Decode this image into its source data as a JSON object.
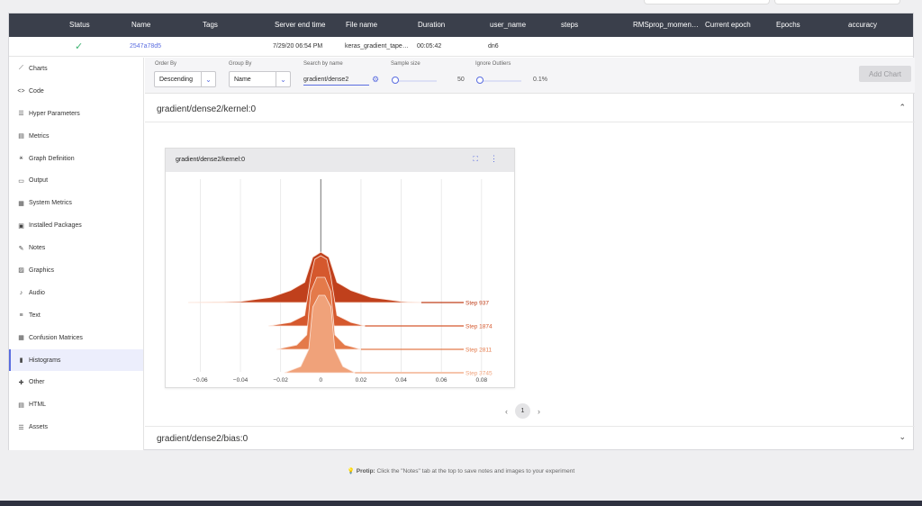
{
  "table": {
    "columns": [
      "Status",
      "Name",
      "Tags",
      "Server end time",
      "File name",
      "Duration",
      "user_name",
      "steps",
      "RMSprop_momen…",
      "Current epoch",
      "Epochs",
      "accuracy"
    ],
    "row": {
      "status_icon": "check-icon",
      "name": "2547a78d5",
      "server_end_time": "7/29/20 06:54 PM",
      "file_name": "keras_gradient_tape…",
      "duration": "00:05:42",
      "user_name": "dn6"
    }
  },
  "sidebar": {
    "items": [
      {
        "label": "Charts",
        "icon": "chart-line-icon",
        "glyph": "⟋"
      },
      {
        "label": "Code",
        "icon": "code-icon",
        "glyph": "<>"
      },
      {
        "label": "Hyper Parameters",
        "icon": "list-icon",
        "glyph": "☰"
      },
      {
        "label": "Metrics",
        "icon": "table-icon",
        "glyph": "▤"
      },
      {
        "label": "Graph Definition",
        "icon": "graph-icon",
        "glyph": "⚹"
      },
      {
        "label": "Output",
        "icon": "laptop-icon",
        "glyph": "▭"
      },
      {
        "label": "System Metrics",
        "icon": "server-icon",
        "glyph": "▦"
      },
      {
        "label": "Installed Packages",
        "icon": "package-icon",
        "glyph": "▣"
      },
      {
        "label": "Notes",
        "icon": "pencil-icon",
        "glyph": "✎"
      },
      {
        "label": "Graphics",
        "icon": "image-icon",
        "glyph": "▨"
      },
      {
        "label": "Audio",
        "icon": "music-icon",
        "glyph": "♪"
      },
      {
        "label": "Text",
        "icon": "text-icon",
        "glyph": "≡"
      },
      {
        "label": "Confusion Matrices",
        "icon": "grid-icon",
        "glyph": "▦"
      },
      {
        "label": "Histograms",
        "icon": "histogram-icon",
        "glyph": "▮"
      },
      {
        "label": "Other",
        "icon": "puzzle-icon",
        "glyph": "✚"
      },
      {
        "label": "HTML",
        "icon": "html-icon",
        "glyph": "▤"
      },
      {
        "label": "Assets",
        "icon": "assets-icon",
        "glyph": "☰"
      }
    ],
    "active": "Histograms"
  },
  "toolbar": {
    "order_by_label": "Order By",
    "order_by_value": "Descending",
    "group_by_label": "Group By",
    "group_by_value": "Name",
    "search_label": "Search by name",
    "search_value": "gradient/dense2",
    "sample_size_label": "Sample size",
    "sample_size_value": "50",
    "ignore_outliers_label": "Ignore Outliers",
    "ignore_outliers_value": "0.1%",
    "add_chart_label": "Add Chart"
  },
  "sections": {
    "kernel_title": "gradient/dense2/kernel:0",
    "bias_title": "gradient/dense2/bias:0"
  },
  "chart_card": {
    "title": "gradient/dense2/kernel:0"
  },
  "pager": {
    "page": "1"
  },
  "protip": {
    "bold": "Protip:",
    "text": "Click the \"Notes\" tab at the top to save notes and images to your experiment"
  },
  "colors": {
    "accent": "#5a6de0",
    "header_bg": "#3a3f4b",
    "step_colors": [
      "#c0401c",
      "#d5582d",
      "#e47a4a",
      "#f0a27a"
    ]
  },
  "chart_data": {
    "type": "area",
    "title": "gradient/dense2/kernel:0",
    "xlim": [
      -0.066,
      0.085
    ],
    "x_ticks": [
      -0.06,
      -0.04,
      -0.02,
      0,
      0.02,
      0.04,
      0.06,
      0.08
    ],
    "x_tick_labels": [
      "−0.06",
      "−0.04",
      "−0.02",
      "0",
      "0.02",
      "0.04",
      "0.06",
      "0.08"
    ],
    "series": [
      {
        "name": "Step 937",
        "x": [
          -0.066,
          -0.04,
          -0.025,
          -0.015,
          -0.008,
          -0.004,
          0,
          0.004,
          0.008,
          0.015,
          0.025,
          0.04,
          0.05
        ],
        "y": [
          0,
          0.02,
          0.1,
          0.24,
          0.4,
          0.9,
          1.0,
          0.9,
          0.4,
          0.24,
          0.1,
          0.02,
          0
        ]
      },
      {
        "name": "Step 1874",
        "x": [
          -0.026,
          -0.015,
          -0.008,
          -0.005,
          -0.003,
          0,
          0.003,
          0.005,
          0.008,
          0.015,
          0.022
        ],
        "y": [
          0,
          0.05,
          0.15,
          0.7,
          0.95,
          1.0,
          0.95,
          0.7,
          0.15,
          0.05,
          0
        ]
      },
      {
        "name": "Step 2811",
        "x": [
          -0.022,
          -0.012,
          -0.007,
          -0.005,
          -0.002,
          0,
          0.002,
          0.005,
          0.007,
          0.012,
          0.02
        ],
        "y": [
          0,
          0.06,
          0.2,
          0.8,
          1.0,
          1.0,
          1.0,
          0.8,
          0.2,
          0.06,
          0
        ]
      },
      {
        "name": "Step 3745",
        "x": [
          -0.018,
          -0.01,
          -0.006,
          -0.004,
          -0.001,
          0,
          0.002,
          0.005,
          0.007,
          0.011,
          0.017
        ],
        "y": [
          0,
          0.08,
          0.3,
          0.85,
          1.0,
          1.0,
          1.0,
          0.85,
          0.3,
          0.08,
          0
        ]
      }
    ],
    "grid": true
  }
}
